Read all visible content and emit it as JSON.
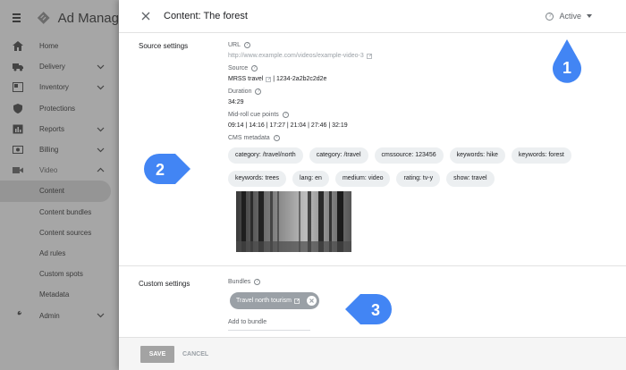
{
  "nav": {
    "brand": "Ad Manag",
    "items": [
      {
        "label": "Home",
        "icon": "home-icon",
        "chevron": false
      },
      {
        "label": "Delivery",
        "icon": "truck-icon",
        "chevron": true
      },
      {
        "label": "Inventory",
        "icon": "inventory-icon",
        "chevron": true
      },
      {
        "label": "Protections",
        "icon": "shield-icon",
        "chevron": false
      },
      {
        "label": "Reports",
        "icon": "bar-chart-icon",
        "chevron": true
      },
      {
        "label": "Billing",
        "icon": "billing-icon",
        "chevron": true
      },
      {
        "label": "Video",
        "icon": "video-icon",
        "chevron": true
      },
      {
        "label": "Content",
        "sub": true,
        "active": true
      },
      {
        "label": "Content bundles",
        "sub": true
      },
      {
        "label": "Content sources",
        "sub": true
      },
      {
        "label": "Ad rules",
        "sub": true
      },
      {
        "label": "Custom spots",
        "sub": true
      },
      {
        "label": "Metadata",
        "sub": true
      },
      {
        "label": "Admin",
        "icon": "wrench-icon",
        "chevron": true
      }
    ]
  },
  "panel": {
    "title": "Content: The forest",
    "status": "Active",
    "source_settings": {
      "label": "Source settings",
      "url_label": "URL",
      "url_value": "http://www.example.com/videos/example-video-3",
      "source_label": "Source",
      "source_link": "MRSS travel",
      "source_id": " | 1234-2a2b2c2d2e",
      "duration_label": "Duration",
      "duration_value": "34:29",
      "cue_label": "Mid-roll cue points",
      "cue_value": "09:14 | 14:16 | 17:27 | 21:04 | 27:46 | 32:19",
      "cms_label": "CMS metadata",
      "chips_row1": [
        "category: /travel/north",
        "category: /travel",
        "cmssource: 123456",
        "keywords: hike",
        "keywords: forest"
      ],
      "chips_row2": [
        "keywords: trees",
        "lang: en",
        "medium: video",
        "rating: tv-y",
        "show: travel"
      ]
    },
    "custom_settings": {
      "label": "Custom settings",
      "bundles_label": "Bundles",
      "bundle_chip": "Travel north tourism",
      "add_placeholder": "Add to bundle"
    },
    "footer": {
      "save": "SAVE",
      "cancel": "CANCEL"
    }
  },
  "callouts": [
    "1",
    "2",
    "3"
  ],
  "colors": {
    "callout": "#4285f4",
    "chip_bg": "#eceff1",
    "nav_bg": "#a6a6a6"
  }
}
